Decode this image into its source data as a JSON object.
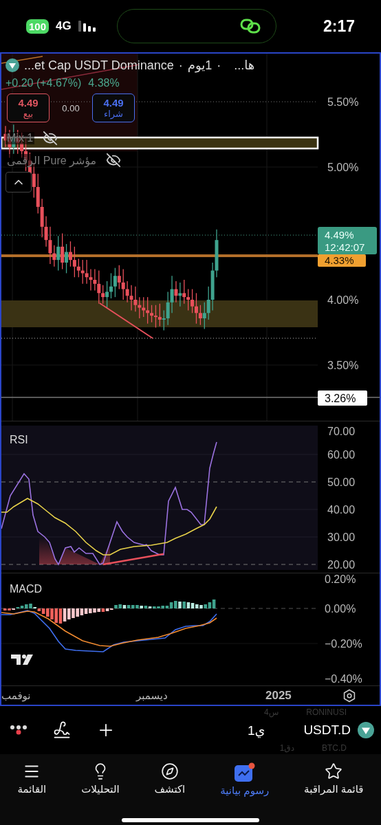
{
  "status_bar": {
    "battery": "100",
    "network": "4G",
    "time": "2:17"
  },
  "chart": {
    "header": {
      "title": "...et Cap USDT Dominance",
      "separator": "·",
      "interval": "1يوم",
      "exchange": "ها...",
      "change": "+0.20 (+4.67%)",
      "price": "4.38%"
    },
    "trade": {
      "sell": {
        "price": "4.49",
        "label": "بيع"
      },
      "spread": "0.00",
      "buy": {
        "price": "4.49",
        "label": "شراء"
      }
    },
    "indicators": [
      {
        "name": "Mix 1",
        "visible": false
      },
      {
        "name": "مؤشر Pure الرقمى",
        "visible": false
      }
    ],
    "price_axis": [
      "5.50%",
      "5.00%",
      "4.00%",
      "3.50%"
    ],
    "last_price": {
      "price": "4.49%",
      "countdown": "12:42:07"
    },
    "level_label": "4.33%",
    "low_label": "3.26%",
    "rsi": {
      "title": "RSI",
      "axis": [
        "70.00",
        "60.00",
        "50.00",
        "40.00",
        "30.00",
        "20.00"
      ]
    },
    "macd": {
      "title": "MACD",
      "axis": [
        "0.20%",
        "0.00%",
        "−0.20%",
        "−0.40%"
      ]
    },
    "time_axis": [
      "2025",
      "ديسمبر",
      "نوفمب"
    ]
  },
  "toolbar": {
    "symbol": "USDT.D",
    "interval": "1ي",
    "list_above": {
      "symbol": "RONINUSI",
      "interval": "4س"
    },
    "list_below": {
      "symbol": "BTC.D",
      "interval": "1دق"
    }
  },
  "tabs": [
    {
      "label": "قائمة المراقبة",
      "kind": "star",
      "selected": false
    },
    {
      "label": "رسوم بيانية",
      "kind": "chart",
      "selected": true
    },
    {
      "label": "اكتشف",
      "kind": "compass",
      "selected": false
    },
    {
      "label": "التحليلات",
      "kind": "bulb",
      "selected": false
    },
    {
      "label": "القائمة",
      "kind": "menu",
      "selected": false
    }
  ]
}
